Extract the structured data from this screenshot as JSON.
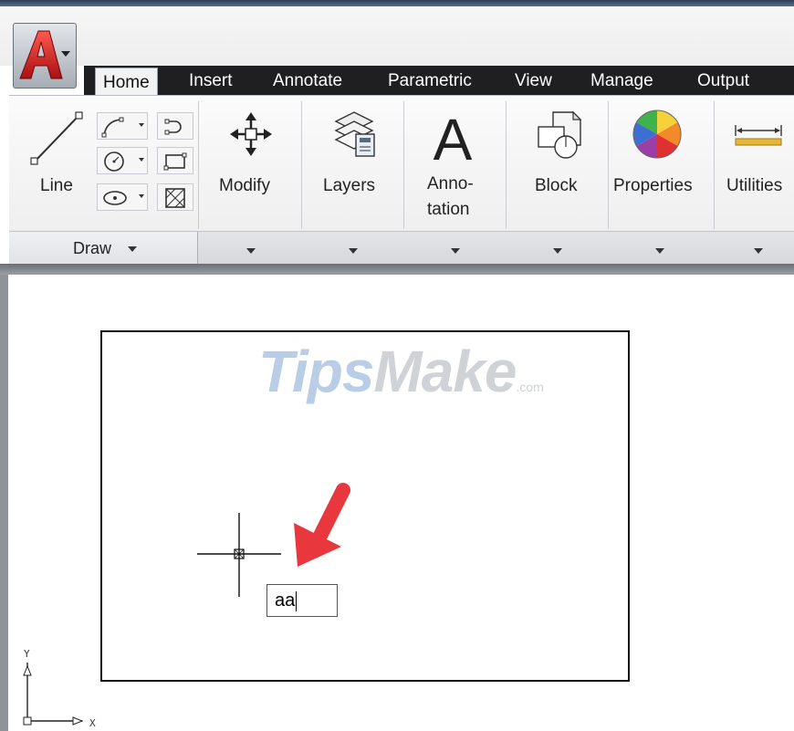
{
  "app_menu": {
    "icon": "autocad-a-logo-icon"
  },
  "ribbon": {
    "tabs": [
      {
        "label": "Home",
        "active": true
      },
      {
        "label": "Insert"
      },
      {
        "label": "Annotate"
      },
      {
        "label": "Parametric"
      },
      {
        "label": "View"
      },
      {
        "label": "Manage"
      },
      {
        "label": "Output"
      }
    ],
    "draw_panel": {
      "line_label": "Line",
      "footer_label": "Draw",
      "tools": [
        "polyline-icon",
        "arc-icon",
        "circle-icon",
        "rectangle-icon",
        "ellipse-icon",
        "hatch-icon"
      ]
    },
    "panels": [
      {
        "label": "Modify",
        "icon": "move-arrows-icon"
      },
      {
        "label": "Layers",
        "icon": "layers-stack-icon"
      },
      {
        "label": "Anno-",
        "label2": "tation",
        "icon": "text-a-icon"
      },
      {
        "label": "Block",
        "icon": "block-icon"
      },
      {
        "label": "Properties",
        "icon": "color-wheel-icon"
      },
      {
        "label": "Utilities",
        "icon": "measure-ruler-icon"
      }
    ]
  },
  "canvas": {
    "watermark": {
      "part1": "Tips",
      "part2": "Make",
      "part3": ".com"
    },
    "text_input_value": "aa",
    "ucs": {
      "x_label": "X",
      "y_label": "Y"
    }
  },
  "colors": {
    "tab_bar": "#1f1f21",
    "arrow": "#e8383d",
    "watermark_blue": "#b9cde6"
  }
}
